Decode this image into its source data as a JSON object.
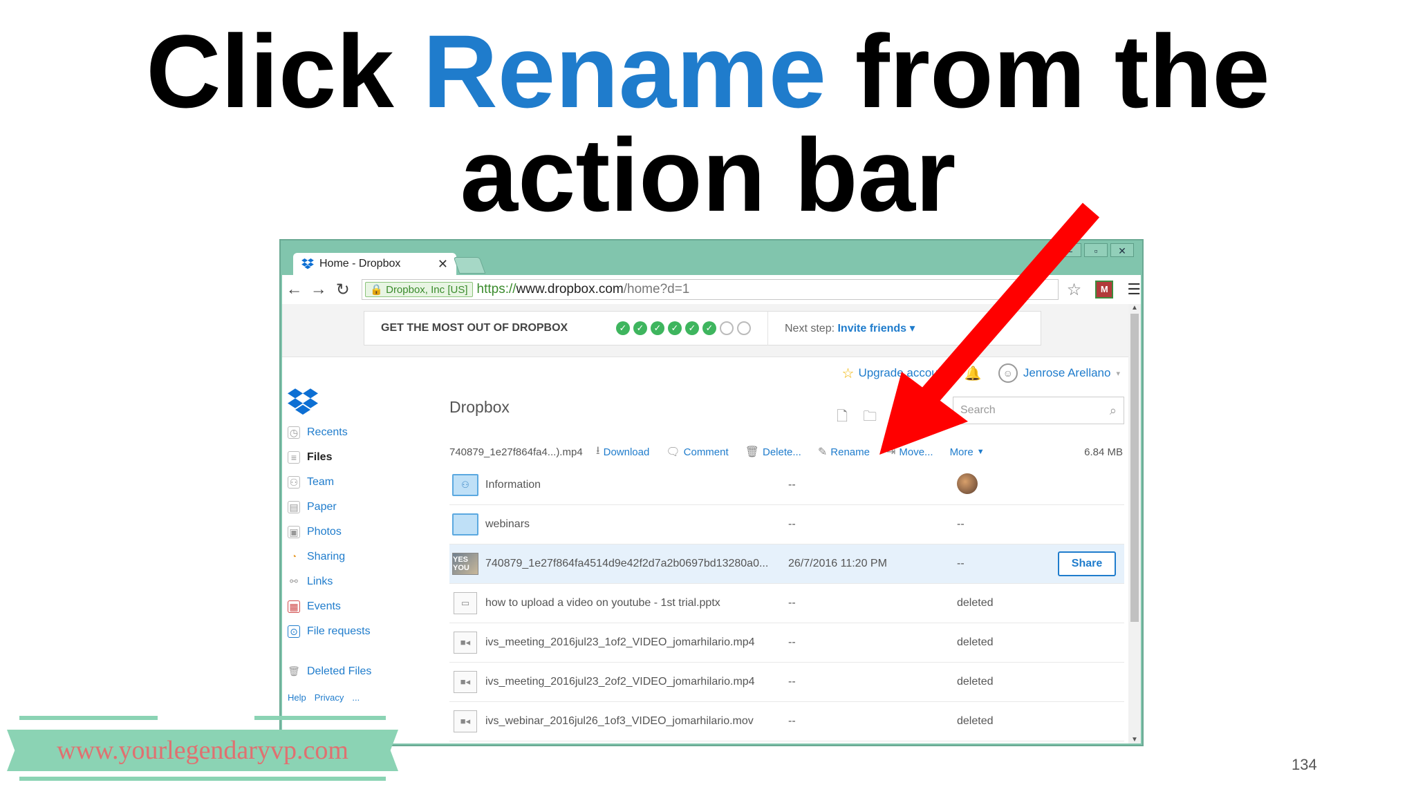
{
  "slide": {
    "title_pre": "Click ",
    "title_highlight": "Rename",
    "title_post": " from the action bar",
    "page_number": "134",
    "watermark": "www.yourlegendaryvp.com"
  },
  "browser": {
    "tab_title": "Home - Dropbox",
    "ev_label": "Dropbox, Inc [US]",
    "url_scheme": "https://",
    "url_host": "www.dropbox.com",
    "url_path": "/home?d=1"
  },
  "promo": {
    "text": "GET THE MOST OUT OF DROPBOX",
    "steps_done": 6,
    "steps_total": 8,
    "next_label": "Next step:",
    "next_link": "Invite friends"
  },
  "header": {
    "upgrade": "Upgrade account",
    "user": "Jenrose Arellano"
  },
  "sidebar": {
    "items": [
      {
        "label": "Recents",
        "icon": "clock-icon"
      },
      {
        "label": "Files",
        "icon": "files-icon"
      },
      {
        "label": "Team",
        "icon": "team-icon"
      },
      {
        "label": "Paper",
        "icon": "paper-icon"
      },
      {
        "label": "Photos",
        "icon": "photos-icon"
      },
      {
        "label": "Sharing",
        "icon": "sharing-icon"
      },
      {
        "label": "Links",
        "icon": "link-icon"
      },
      {
        "label": "Events",
        "icon": "calendar-icon"
      },
      {
        "label": "File requests",
        "icon": "file-request-icon"
      }
    ],
    "deleted": "Deleted Files",
    "footer": [
      "Help",
      "Privacy",
      "..."
    ]
  },
  "main": {
    "title": "Dropbox",
    "search_placeholder": "Search"
  },
  "action_bar": {
    "selected_file": "740879_1e27f864fa4...).mp4",
    "actions": [
      "Download",
      "Comment",
      "Delete...",
      "Rename",
      "Move...",
      "More"
    ],
    "size": "6.84 MB"
  },
  "files": [
    {
      "name": "Information",
      "modified": "--",
      "type": "shared-folder"
    },
    {
      "name": "webinars",
      "modified": "--",
      "shared": "--",
      "type": "folder"
    },
    {
      "name": "740879_1e27f864fa4514d9e42f2d7a2b0697bd13280a0...",
      "modified": "26/7/2016 11:20 PM",
      "shared": "--",
      "type": "video-thumb",
      "thumb_text": "YES YOU",
      "action": "Share"
    },
    {
      "name": "how to upload a video on youtube - 1st trial.pptx",
      "modified": "--",
      "shared": "deleted",
      "type": "pptx"
    },
    {
      "name": "ivs_meeting_2016jul23_1of2_VIDEO_jomarhilario.mp4",
      "modified": "--",
      "shared": "deleted",
      "type": "video"
    },
    {
      "name": "ivs_meeting_2016jul23_2of2_VIDEO_jomarhilario.mp4",
      "modified": "--",
      "shared": "deleted",
      "type": "video"
    },
    {
      "name": "ivs_webinar_2016jul26_1of3_VIDEO_jomarhilario.mov",
      "modified": "--",
      "shared": "deleted",
      "type": "video"
    }
  ],
  "colors": {
    "accent": "#1f7ccc",
    "arrow": "#ff0000",
    "frame": "#81c5ad"
  }
}
